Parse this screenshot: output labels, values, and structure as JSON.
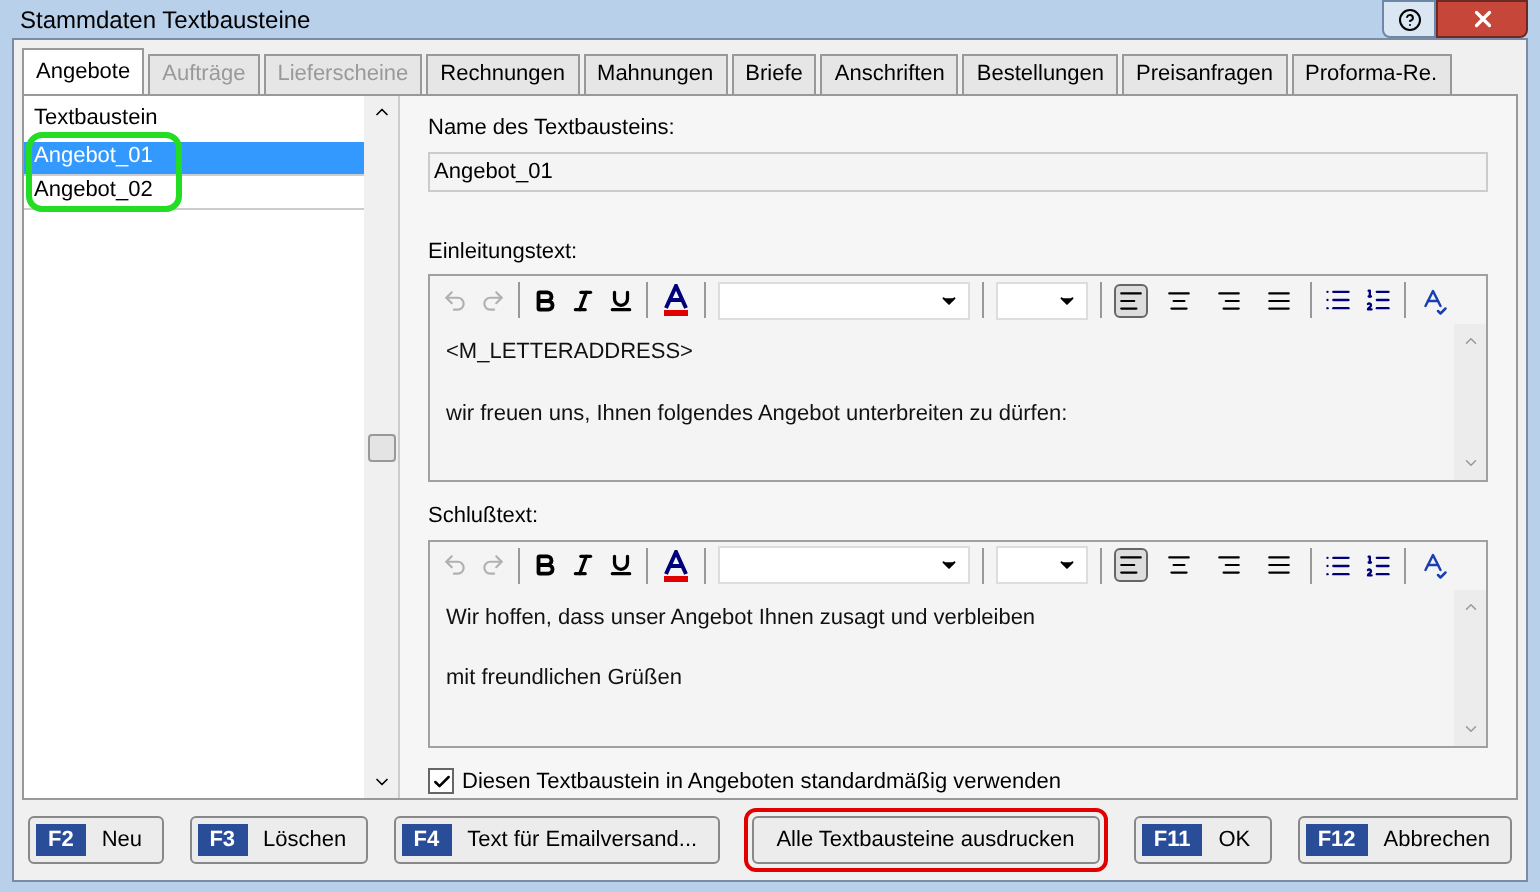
{
  "window": {
    "title": "Stammdaten Textbausteine"
  },
  "tabs": [
    {
      "label": "Angebote",
      "selected": true,
      "disabled": false
    },
    {
      "label": "Aufträge",
      "selected": false,
      "disabled": true
    },
    {
      "label": "Lieferscheine",
      "selected": false,
      "disabled": true
    },
    {
      "label": "Rechnungen",
      "selected": false,
      "disabled": false
    },
    {
      "label": "Mahnungen",
      "selected": false,
      "disabled": false
    },
    {
      "label": "Briefe",
      "selected": false,
      "disabled": false
    },
    {
      "label": "Anschriften",
      "selected": false,
      "disabled": false
    },
    {
      "label": "Bestellungen",
      "selected": false,
      "disabled": false
    },
    {
      "label": "Preisanfragen",
      "selected": false,
      "disabled": false
    },
    {
      "label": "Proforma-Re.",
      "selected": false,
      "disabled": false
    }
  ],
  "list": {
    "header": "Textbaustein",
    "highlighted": true,
    "items": [
      {
        "label": "Angebot_01",
        "selected": true
      },
      {
        "label": "Angebot_02",
        "selected": false
      }
    ]
  },
  "name_field": {
    "label": "Name des Textbausteins:",
    "value": "Angebot_01"
  },
  "editors": [
    {
      "label": "Einleitungstext:",
      "left_aligned": true,
      "lines": [
        "<M_LETTERADDRESS>",
        "wir freuen uns, Ihnen folgendes Angebot unterbreiten zu dürfen:"
      ]
    },
    {
      "label": "Schlußtext:",
      "left_aligned": true,
      "lines": [
        "Wir hoffen, dass unser Angebot Ihnen zusagt und verbleiben",
        "mit freundlichen Grüßen"
      ]
    }
  ],
  "checkbox": {
    "label": "Diesen Textbaustein in Angeboten standardmäßig verwenden",
    "checked": true
  },
  "buttons": [
    {
      "key": "F2",
      "label": "Neu",
      "highlighted": false
    },
    {
      "key": "F3",
      "label": "Löschen",
      "highlighted": false
    },
    {
      "key": "F4",
      "label": "Text für Emailversand...",
      "highlighted": false
    },
    {
      "label": "Alle Textbausteine ausdrucken",
      "highlighted": true
    },
    {
      "key": "F11",
      "label": "OK",
      "highlighted": false
    },
    {
      "key": "F12",
      "label": "Abbrechen",
      "highlighted": false
    }
  ]
}
